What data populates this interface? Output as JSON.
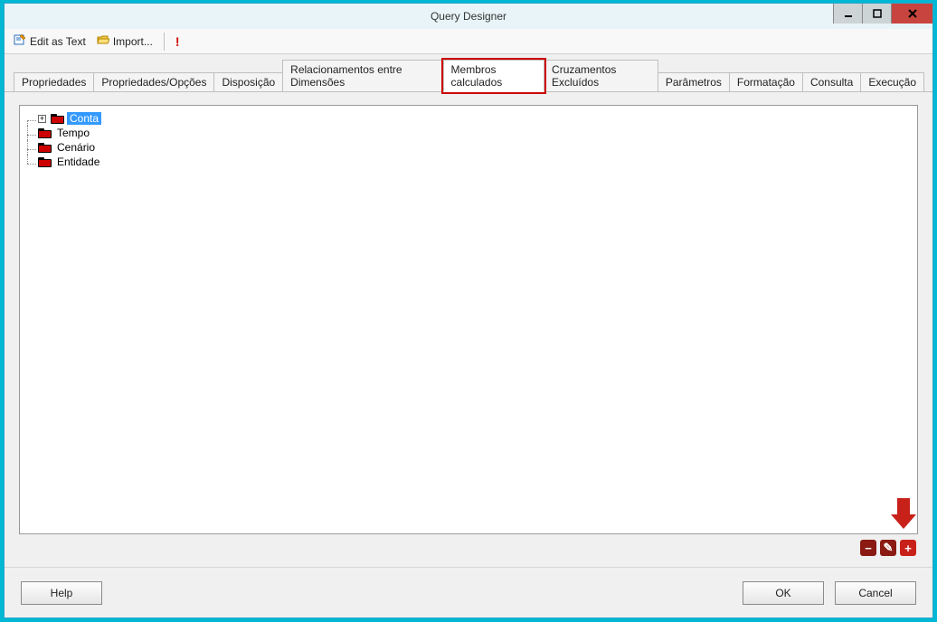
{
  "window": {
    "title": "Query Designer"
  },
  "toolbar": {
    "edit_as_text": "Edit as Text",
    "import": "Import..."
  },
  "tabs": [
    {
      "label": "Propriedades"
    },
    {
      "label": "Propriedades/Opções"
    },
    {
      "label": "Disposição"
    },
    {
      "label": "Relacionamentos entre Dimensões"
    },
    {
      "label": "Membros calculados",
      "active": true,
      "highlight": true
    },
    {
      "label": "Cruzamentos Excluídos"
    },
    {
      "label": "Parâmetros"
    },
    {
      "label": "Formatação"
    },
    {
      "label": "Consulta"
    },
    {
      "label": "Execução"
    }
  ],
  "tree": {
    "items": [
      {
        "label": "Conta",
        "selected": true,
        "expandable": true
      },
      {
        "label": "Tempo"
      },
      {
        "label": "Cenário"
      },
      {
        "label": "Entidade"
      }
    ]
  },
  "actions": {
    "remove_icon": "−",
    "edit_icon": "✎",
    "add_icon": "+"
  },
  "footer": {
    "help": "Help",
    "ok": "OK",
    "cancel": "Cancel"
  }
}
